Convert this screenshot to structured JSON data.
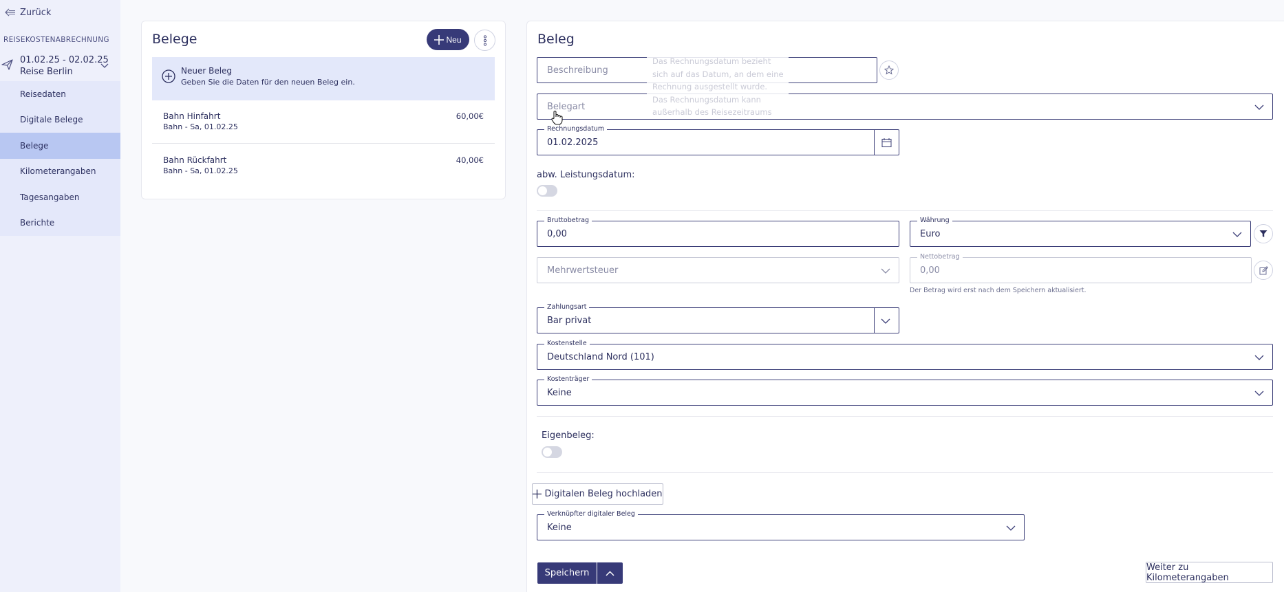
{
  "sidebar": {
    "back_label": "Zurück",
    "section_title": "REISEKOSTENABRECHNUNG",
    "trip_dates": "01.02.25 - 02.02.25",
    "trip_name": "Reise Berlin",
    "items": [
      {
        "label": "Reisedaten"
      },
      {
        "label": "Digitale Belege"
      },
      {
        "label": "Belege"
      },
      {
        "label": "Kilometerangaben"
      },
      {
        "label": "Tagesangaben"
      },
      {
        "label": "Berichte"
      }
    ],
    "active_item": "Belege"
  },
  "list": {
    "title": "Belege",
    "new_button_label": "Neu",
    "new_entry": {
      "title": "Neuer Beleg",
      "subtitle": "Geben Sie die Daten für den neuen Beleg ein."
    },
    "entries": [
      {
        "name": "Bahn Hinfahrt",
        "detail": "Bahn - Sa, 01.02.25",
        "amount": "60,00€"
      },
      {
        "name": "Bahn Rückfahrt",
        "detail": "Bahn - Sa, 01.02.25",
        "amount": "40,00€"
      }
    ]
  },
  "form": {
    "title": "Beleg",
    "beschreibung_placeholder": "Beschreibung",
    "belegart_placeholder": "Belegart",
    "rechnungsdatum_label": "Rechnungsdatum",
    "rechnungsdatum_value": "01.02.2025",
    "leistungsdatum_label": "abw. Leistungsdatum:",
    "brutto_label": "Bruttobetrag",
    "brutto_value": "0,00",
    "waehrung_label": "Währung",
    "waehrung_value": "Euro",
    "mwst_placeholder": "Mehrwertsteuer",
    "netto_label": "Nettobetrag",
    "netto_value": "0,00",
    "netto_hint": "Der Betrag wird erst nach dem Speichern aktualisiert.",
    "zahlungsart_label": "Zahlungsart",
    "zahlungsart_value": "Bar privat",
    "kostenstelle_label": "Kostenstelle",
    "kostenstelle_value": "Deutschland Nord (101)",
    "kostentraeger_label": "Kostenträger",
    "kostentraeger_value": "Keine",
    "eigenbeleg_label": "Eigenbeleg:",
    "upload_label": "Digitalen Beleg hochladen",
    "verknuepft_label": "Verknüpfter digitaler Beleg",
    "verknuepft_value": "Keine",
    "save_label": "Speichern",
    "next_label": "Weiter zu Kilometerangaben"
  },
  "tooltip": {
    "text": "Das Rechnungsdatum bezieht sich auf das Datum, an dem eine Rechnung ausgestellt wurde. Das Rechnungsdatum kann außerhalb des Reisezeitraums liegen."
  },
  "colors": {
    "primary": "#373a78",
    "sidebar_bg": "#eef0fb",
    "nav_bg": "#e4e8fa",
    "nav_active": "#b8c7f2",
    "new_entry_bg": "#e3e8fa"
  }
}
